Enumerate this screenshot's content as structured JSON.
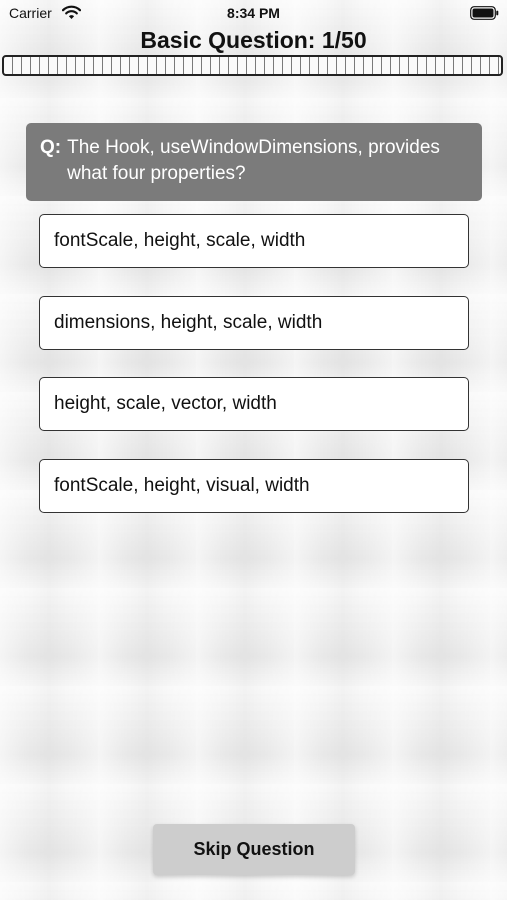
{
  "status_bar": {
    "carrier": "Carrier",
    "time": "8:34 PM",
    "icons": [
      "wifi-icon",
      "battery-icon"
    ]
  },
  "header": {
    "title": "Basic Question: 1/50"
  },
  "progress": {
    "current": 1,
    "total": 50,
    "fraction": 0
  },
  "question": {
    "prefix": "Q:",
    "text": "The Hook, useWindowDimensions, provides what four properties?"
  },
  "answers": [
    {
      "label": "fontScale, height, scale, width"
    },
    {
      "label": "dimensions, height, scale, width"
    },
    {
      "label": "height, scale, vector, width"
    },
    {
      "label": "fontScale, height, visual, width"
    }
  ],
  "actions": {
    "skip_label": "Skip Question"
  },
  "colors": {
    "question_background": "#7b7b7b",
    "answer_background": "#ffffff",
    "skip_background": "#cdcdcd",
    "page_background": "#f1f1f1"
  }
}
